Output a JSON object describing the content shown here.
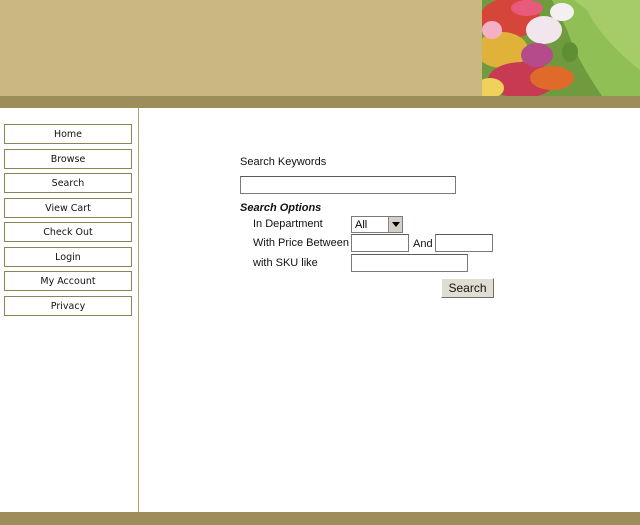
{
  "nav": {
    "items": [
      {
        "label": "Home"
      },
      {
        "label": "Browse"
      },
      {
        "label": "Search"
      },
      {
        "label": "View Cart"
      },
      {
        "label": "Check Out"
      },
      {
        "label": "Login"
      },
      {
        "label": "My Account"
      },
      {
        "label": "Privacy"
      }
    ]
  },
  "search": {
    "keywords_label": "Search Keywords",
    "keywords_value": "",
    "options_title": "Search Options",
    "department_label": "In Department",
    "department_selected": "All",
    "price_label": "With Price Between",
    "price_and_label": "And",
    "price_min_value": "",
    "price_max_value": "",
    "sku_label": "with SKU like",
    "sku_value": "",
    "button_label": "Search"
  },
  "colors": {
    "header": "#c9b882",
    "stripe": "#9c8d5a",
    "nav_border": "#8c8456"
  },
  "icons": {
    "dropdown": "chevron-down-icon",
    "banner": "flower-garden-image"
  }
}
